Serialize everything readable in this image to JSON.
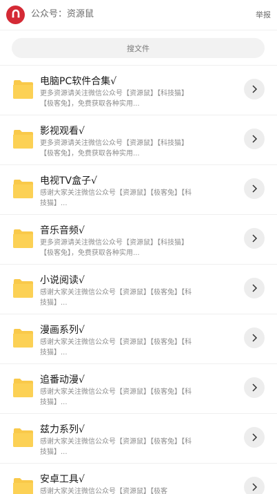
{
  "header": {
    "title": "公众号：资源鼠",
    "report_label": "举报",
    "avatar_icon": "magnet-icon",
    "avatar_color": "#d42a35"
  },
  "search": {
    "placeholder": "搜文件"
  },
  "folder_color": "#f9c94a",
  "items": [
    {
      "title": "电脑PC软件合集√",
      "desc": "更多资源请关注微信公众号【资源鼠】【科技猫】【极客兔】，免费获取各种实用..."
    },
    {
      "title": "影视观看√",
      "desc": "更多资源请关注微信公众号【资源鼠】【科技猫】【极客兔】，免费获取各种实用..."
    },
    {
      "title": "电视TV盒子√",
      "desc": "感谢大家关注微信公众号【资源鼠】【极客兔】【科技猫】..."
    },
    {
      "title": "音乐音频√",
      "desc": "更多资源请关注微信公众号【资源鼠】【科技猫】【极客兔】，免费获取各种实用..."
    },
    {
      "title": "小说阅读√",
      "desc": "感谢大家关注微信公众号【资源鼠】【极客兔】【科技猫】..."
    },
    {
      "title": "漫画系列√",
      "desc": "感谢大家关注微信公众号【资源鼠】【极客兔】【科技猫】..."
    },
    {
      "title": "追番动漫√",
      "desc": "感谢大家关注微信公众号【资源鼠】【极客兔】【科技猫】..."
    },
    {
      "title": "兹力系列√",
      "desc": "感谢大家关注微信公众号【资源鼠】【极客兔】【科技猫】..."
    },
    {
      "title": "安卓工具√",
      "desc": "感谢大家关注微信公众号【资源鼠】【极客"
    }
  ]
}
